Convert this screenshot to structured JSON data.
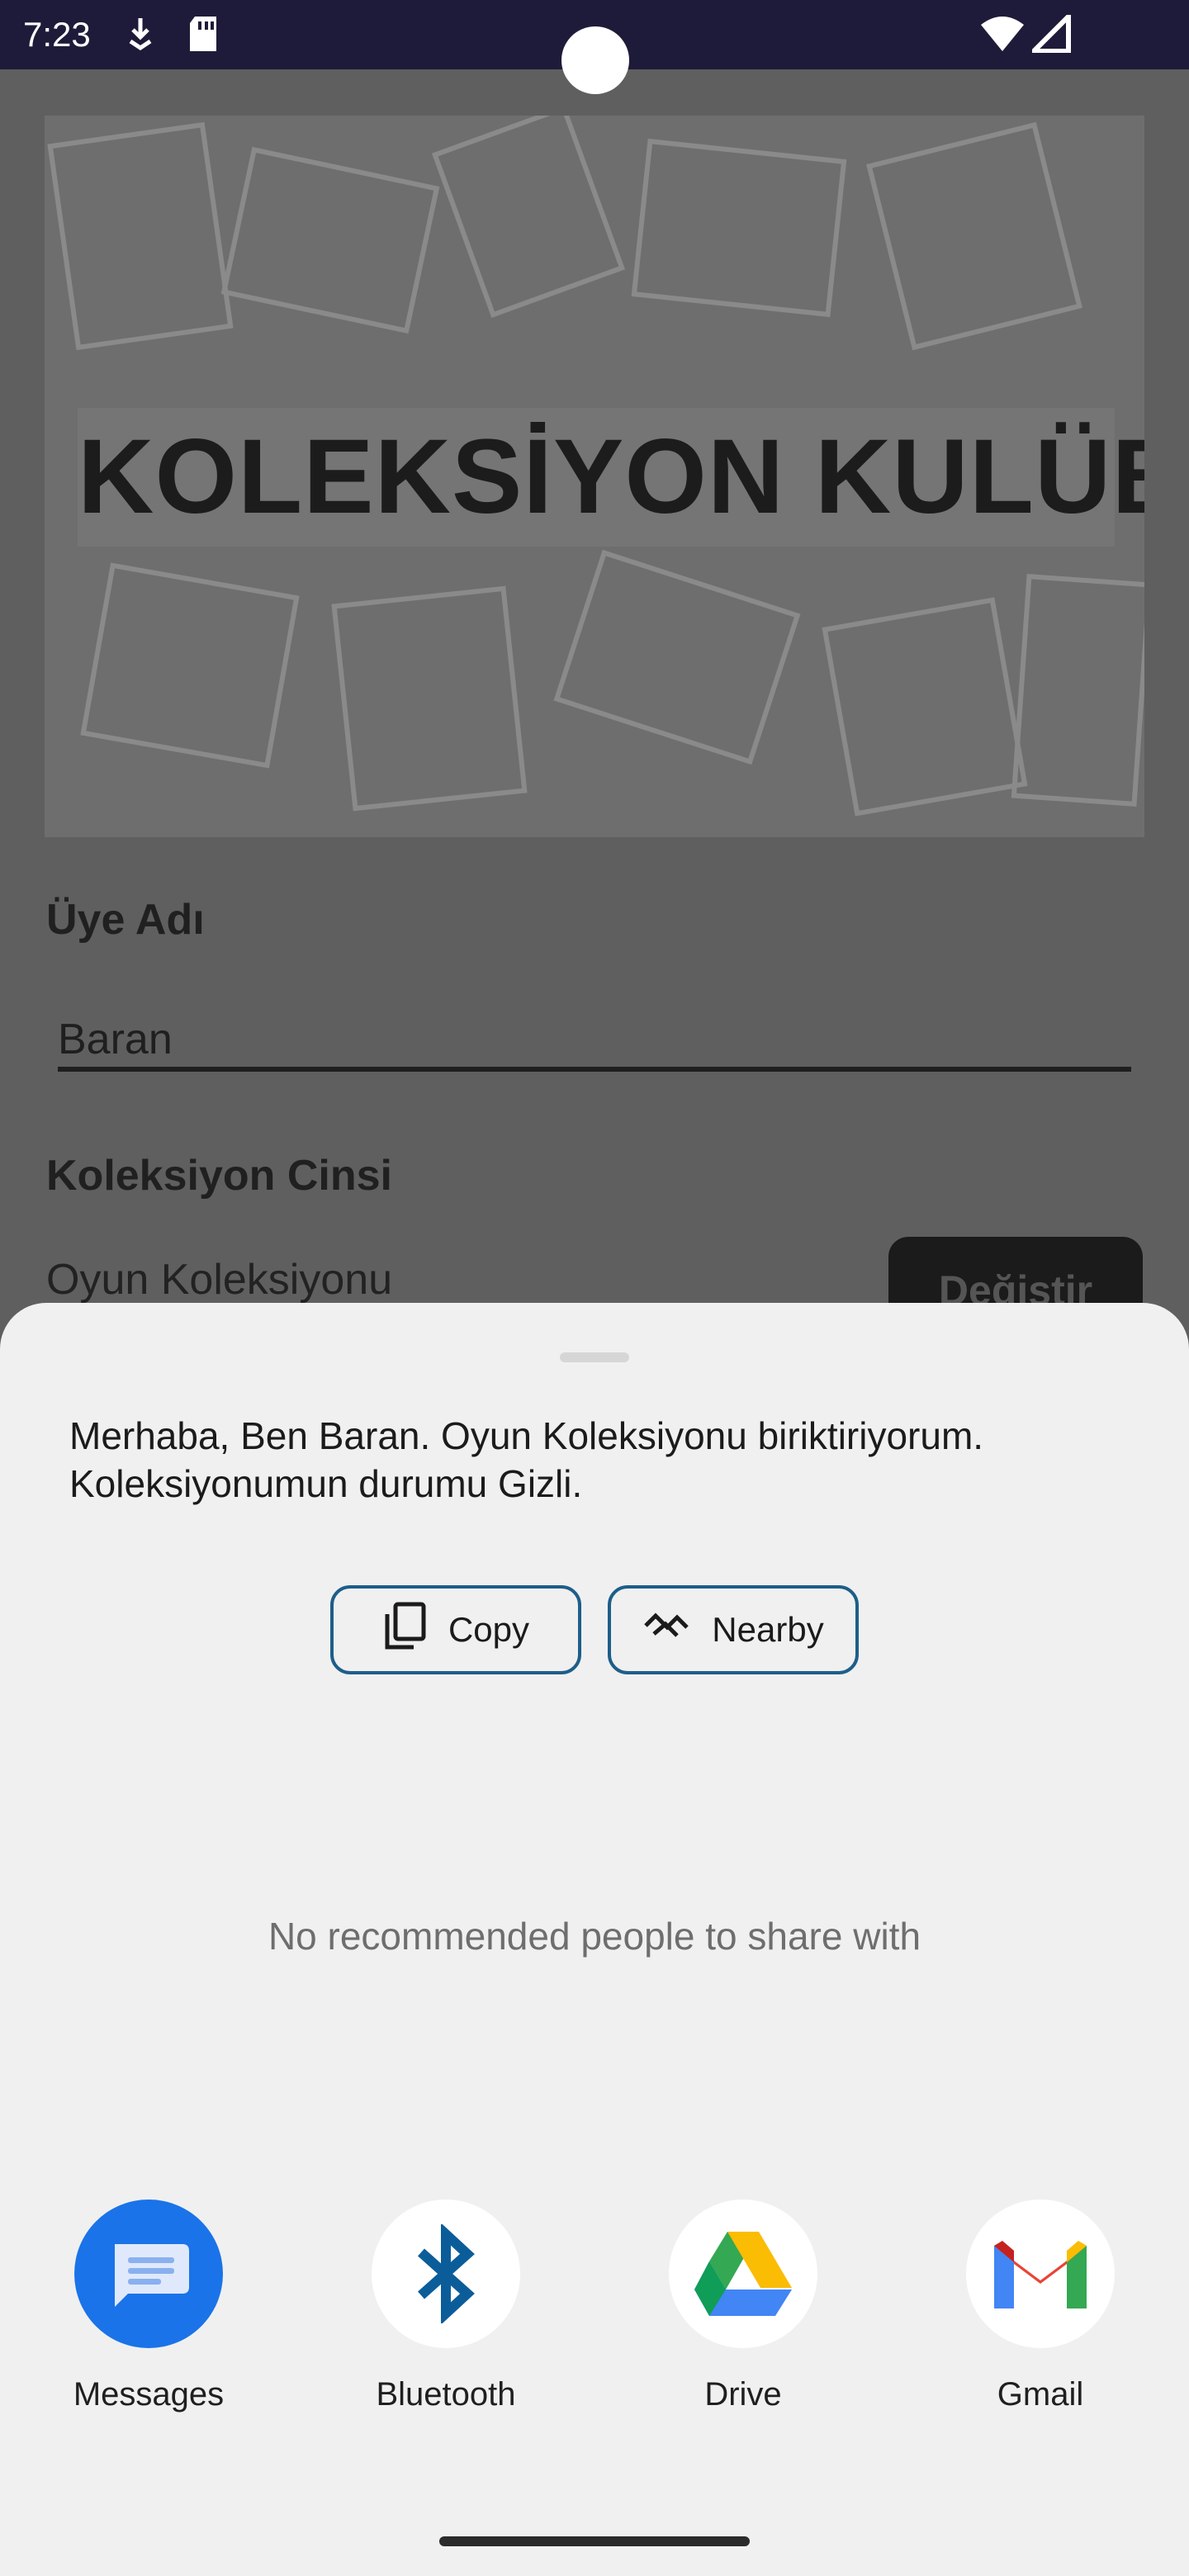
{
  "status_bar": {
    "time": "7:23",
    "icons": [
      "download-arrow-icon",
      "sd-card-icon",
      "wifi-icon",
      "cell-signal-icon"
    ]
  },
  "app": {
    "banner_title": "KOLEKSİYON KULÜBÜ",
    "member_name_label": "Üye Adı",
    "member_name_value": "Baran",
    "collection_type_label": "Koleksiyon Cinsi",
    "collection_type_value": "Oyun Koleksiyonu",
    "change_button_label": "Değiştir"
  },
  "share_sheet": {
    "message": "Merhaba, Ben Baran. Oyun Koleksiyonu biriktiriyorum. Koleksiyonumun durumu Gizli.",
    "copy_label": "Copy",
    "nearby_label": "Nearby",
    "empty_recommendations": "No recommended people to share with",
    "apps": [
      {
        "label": "Messages",
        "icon": "messages-icon",
        "color": "#1a73e8"
      },
      {
        "label": "Bluetooth",
        "icon": "bluetooth-icon",
        "color": "#0b5d9a"
      },
      {
        "label": "Drive",
        "icon": "google-drive-icon",
        "color": "#34a853"
      },
      {
        "label": "Gmail",
        "icon": "gmail-icon",
        "color": "#ea4335"
      }
    ]
  }
}
